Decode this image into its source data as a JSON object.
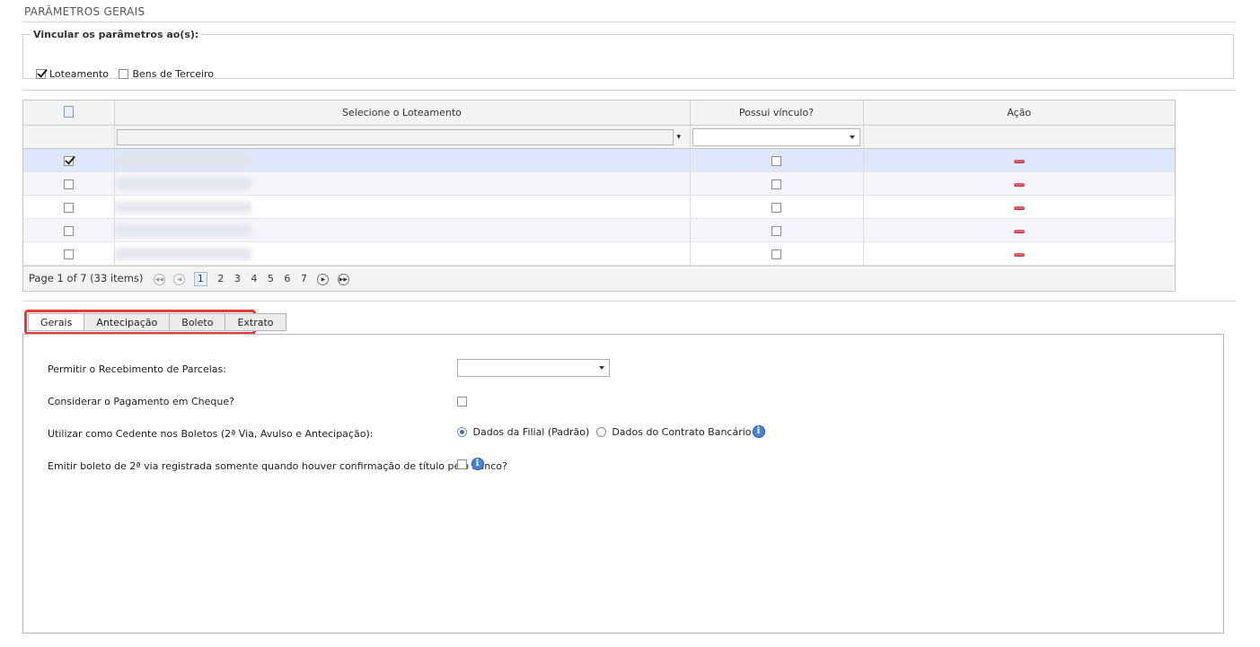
{
  "section": {
    "title": "PARÂMETROS GERAIS"
  },
  "vinculo": {
    "legend": "Vincular os parâmetros ao(s):",
    "options": [
      {
        "label": "Loteamento",
        "checked": true
      },
      {
        "label": "Bens de Terceiro",
        "checked": false
      }
    ]
  },
  "grid": {
    "columns": [
      "Selecione o Loteamento",
      "Possui vínculo?",
      "Ação"
    ],
    "filter": {
      "value": "",
      "select_value": ""
    },
    "rows": [
      {
        "selected": true,
        "possui_vinculo": false
      },
      {
        "selected": false,
        "possui_vinculo": false
      },
      {
        "selected": false,
        "possui_vinculo": false
      },
      {
        "selected": false,
        "possui_vinculo": false
      },
      {
        "selected": false,
        "possui_vinculo": false
      }
    ],
    "pager": {
      "text": "Page 1 of 7 (33 items)",
      "pages": [
        "1",
        "2",
        "3",
        "4",
        "5",
        "6",
        "7"
      ],
      "current": "1"
    }
  },
  "tabs": [
    {
      "label": "Gerais",
      "active": true
    },
    {
      "label": "Antecipação",
      "active": false
    },
    {
      "label": "Boleto",
      "active": false
    },
    {
      "label": "Extrato",
      "active": false
    }
  ],
  "gerais": {
    "permitir_label": "Permitir o Recebimento de Parcelas:",
    "permitir_value": "",
    "cheque_label": "Considerar o Pagamento em Cheque?",
    "cedente_label": "Utilizar como Cedente nos Boletos (2ª Via, Avulso e Antecipação):",
    "cedente_opt1": "Dados da Filial (Padrão)",
    "cedente_opt2": "Dados do Contrato Bancário",
    "emitir_label": "Emitir boleto de 2ª via registrada somente quando houver confirmação de título pelo banco?"
  },
  "colors": {
    "highlight": "#e23b3b",
    "selected_row": "#dde6fb",
    "info": "#4a82d4"
  }
}
